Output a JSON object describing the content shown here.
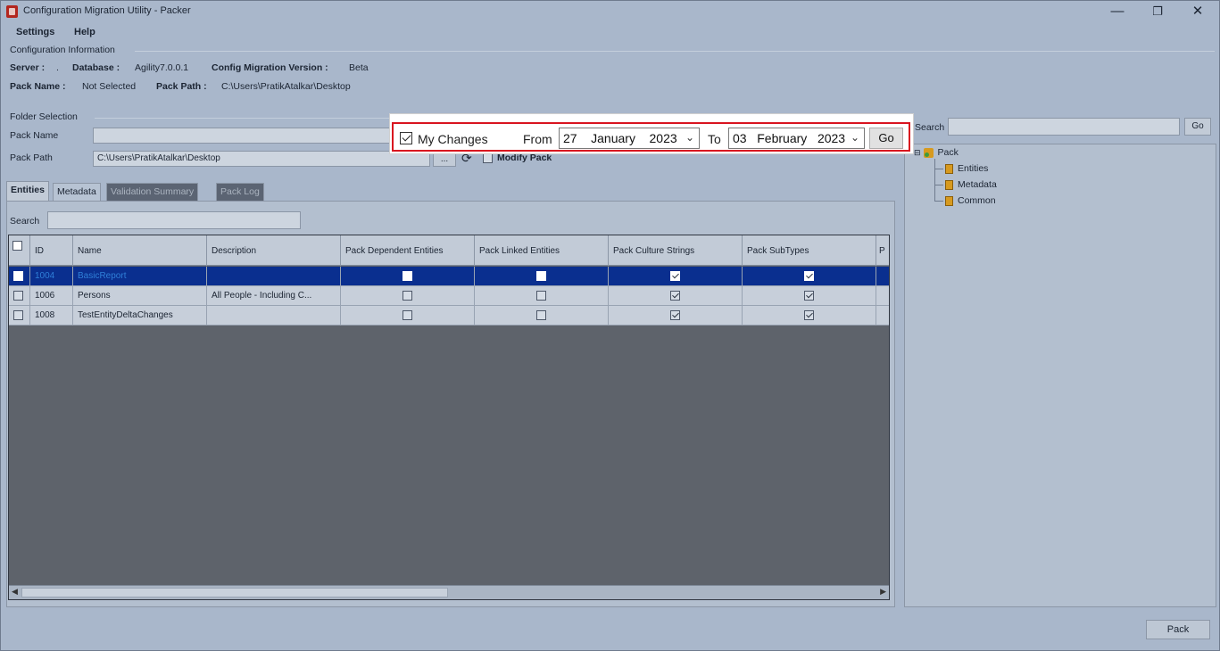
{
  "window": {
    "title": "Configuration Migration Utility - Packer",
    "minimize": "—",
    "restore": "❐",
    "close": "✕"
  },
  "menu": [
    "Settings",
    "Help"
  ],
  "config": {
    "section_title": "Configuration Information",
    "server_label": "Server :",
    "server_value": ".",
    "database_label": "Database :",
    "database_value": "Agility7.0.0.1",
    "version_label": "Config Migration Version :",
    "version_value": "Beta",
    "pack_name_label": "Pack Name :",
    "pack_name_value": "Not Selected",
    "pack_path_label": "Pack Path :",
    "pack_path_value": "C:\\Users\\PratikAtalkar\\Desktop"
  },
  "folder": {
    "section_title": "Folder Selection",
    "pack_name_label": "Pack Name",
    "pack_name_value": "",
    "pack_path_label": "Pack Path",
    "pack_path_value": "C:\\Users\\PratikAtalkar\\Desktop",
    "browse_label": "...",
    "modify_pack_label": "Modify Pack"
  },
  "tabs": [
    "Entities",
    "Metadata",
    "Validation Summary",
    "Pack Log"
  ],
  "search": {
    "label": "Search",
    "value": ""
  },
  "grid": {
    "columns": [
      "ID",
      "Name",
      "Description",
      "Pack Dependent Entities",
      "Pack Linked Entities",
      "Pack Culture Strings",
      "Pack SubTypes",
      "P"
    ],
    "rows": [
      {
        "id": "1004",
        "name": "BasicReport",
        "description": "",
        "dependent": false,
        "linked": false,
        "culture": true,
        "subtypes": true
      },
      {
        "id": "1006",
        "name": "Persons",
        "description": "All People - Including C...",
        "dependent": false,
        "linked": false,
        "culture": true,
        "subtypes": true
      },
      {
        "id": "1008",
        "name": "TestEntityDeltaChanges",
        "description": "",
        "dependent": false,
        "linked": false,
        "culture": true,
        "subtypes": true
      }
    ]
  },
  "right_panel": {
    "search_label": "Search",
    "search_value": "",
    "go_label": "Go",
    "tree_root": "Pack",
    "tree_children": [
      "Entities",
      "Metadata",
      "Common"
    ]
  },
  "popup": {
    "my_changes_label": "My Changes",
    "my_changes_checked": true,
    "from_label": "From",
    "from_day": "27",
    "from_month": "January",
    "from_year": "2023",
    "to_label": "To",
    "to_day": "03",
    "to_month": "February",
    "to_year": "2023",
    "go_label": "Go",
    "dropdown_glyph": "⌵"
  },
  "footer": {
    "pack_button": "Pack"
  },
  "colors": {
    "window_bg": "#a9b7cb",
    "selected_row": "#0a2f8f",
    "highlight_frame": "#d9141f"
  }
}
